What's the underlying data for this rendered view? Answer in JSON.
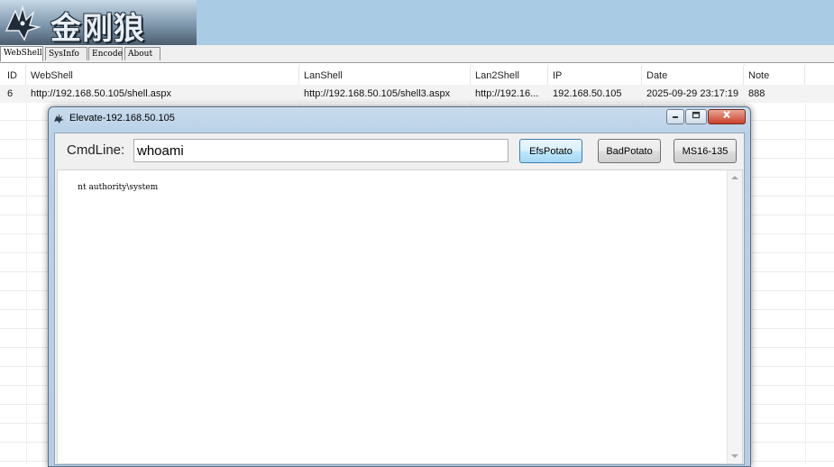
{
  "app": {
    "logo_text": "金刚狼"
  },
  "tabs": [
    {
      "label": "WebShell",
      "active": true
    },
    {
      "label": "SysInfo",
      "active": false
    },
    {
      "label": "Encode",
      "active": false
    },
    {
      "label": "About",
      "active": false
    }
  ],
  "table": {
    "columns": [
      "ID",
      "WebShell",
      "LanShell",
      "Lan2Shell",
      "IP",
      "Date",
      "Note"
    ],
    "rows": [
      {
        "id": "6",
        "webshell": "http://192.168.50.105/shell.aspx",
        "lanshell": "http://192.168.50.105/shell3.aspx",
        "lan2shell": "http://192.16...",
        "ip": "192.168.50.105",
        "date": "2025-09-29 23:17:19",
        "note": "888"
      }
    ]
  },
  "dialog": {
    "title": "Elevate-192.168.50.105",
    "cmd_label": "CmdLine:",
    "cmd_value": "whoami",
    "buttons": {
      "efs": "EfsPotato",
      "bad": "BadPotato",
      "ms16": "MS16-135"
    },
    "output": "nt authority\\system"
  },
  "colors": {
    "banner": "#a9cbe3",
    "dialog_frame": "#b9d0e6",
    "close_button": "#c8422b"
  }
}
